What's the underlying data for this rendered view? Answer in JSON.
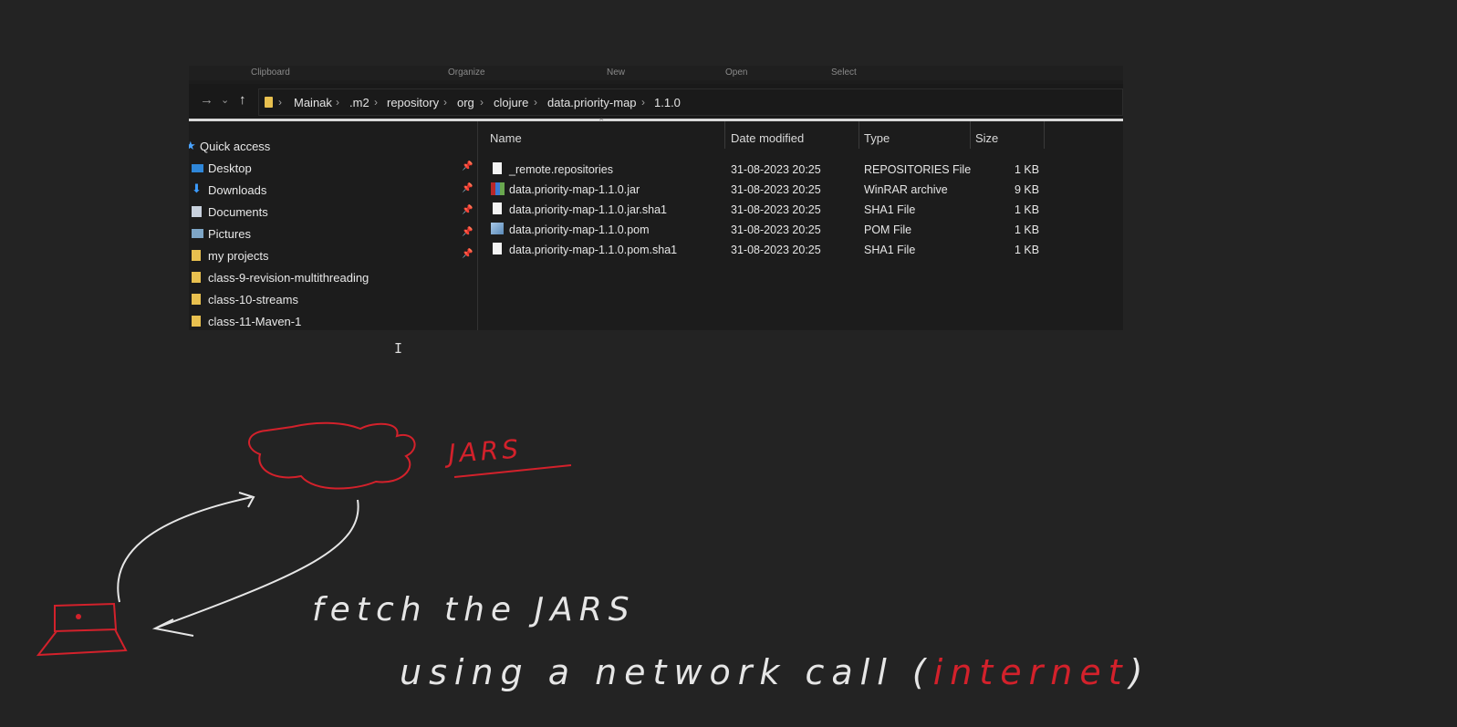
{
  "ribbon": {
    "labels": [
      "Clipboard",
      "Organize",
      "New",
      "Open",
      "Select"
    ]
  },
  "address_bar": {
    "crumbs": [
      "Mainak",
      ".m2",
      "repository",
      "org",
      "clojure",
      "data.priority-map",
      "1.1.0"
    ]
  },
  "nav_pane": {
    "items": [
      {
        "label": "Quick access",
        "icon": "star-icon",
        "pinned": false
      },
      {
        "label": "Desktop",
        "icon": "desktop-icon",
        "pinned": true
      },
      {
        "label": "Downloads",
        "icon": "download-arrow-icon",
        "pinned": true
      },
      {
        "label": "Documents",
        "icon": "document-icon",
        "pinned": true
      },
      {
        "label": "Pictures",
        "icon": "picture-icon",
        "pinned": true
      },
      {
        "label": "my projects",
        "icon": "folder-icon",
        "pinned": true
      },
      {
        "label": "class-9-revision-multithreading",
        "icon": "folder-icon",
        "pinned": false
      },
      {
        "label": "class-10-streams",
        "icon": "folder-icon",
        "pinned": false
      },
      {
        "label": "class-11-Maven-1",
        "icon": "folder-icon",
        "pinned": false
      }
    ]
  },
  "file_list": {
    "columns": [
      "Name",
      "Date modified",
      "Type",
      "Size"
    ],
    "rows": [
      {
        "name": "_remote.repositories",
        "date": "31-08-2023 20:25",
        "type": "REPOSITORIES File",
        "size": "1 KB",
        "icon": "blank-file-icon"
      },
      {
        "name": "data.priority-map-1.1.0.jar",
        "date": "31-08-2023 20:25",
        "type": "WinRAR archive",
        "size": "9 KB",
        "icon": "winrar-archive-icon"
      },
      {
        "name": "data.priority-map-1.1.0.jar.sha1",
        "date": "31-08-2023 20:25",
        "type": "SHA1 File",
        "size": "1 KB",
        "icon": "blank-file-icon"
      },
      {
        "name": "data.priority-map-1.1.0.pom",
        "date": "31-08-2023 20:25",
        "type": "POM File",
        "size": "1 KB",
        "icon": "pom-file-icon"
      },
      {
        "name": "data.priority-map-1.1.0.pom.sha1",
        "date": "31-08-2023 20:25",
        "type": "SHA1 File",
        "size": "1 KB",
        "icon": "blank-file-icon"
      }
    ]
  },
  "handwriting": {
    "jars_label": "JARS",
    "line1": "fetch the JARS",
    "line2_a": "using a network call (",
    "line2_b": "internet",
    "line2_c": ")"
  },
  "colors": {
    "background": "#232323",
    "red_ink": "#d3212b",
    "white_ink": "#e6e6e6",
    "folder": "#e8c04f"
  }
}
